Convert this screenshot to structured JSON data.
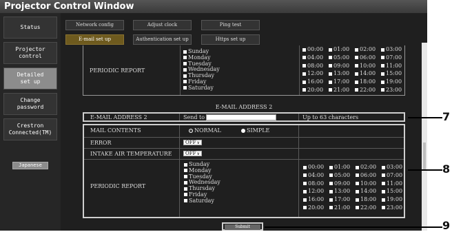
{
  "window": {
    "title": "Projector Control Window"
  },
  "sidebar": {
    "items": [
      {
        "label": "Status",
        "active": false
      },
      {
        "label": "Projector\ncontrol",
        "active": false
      },
      {
        "label": "Detailed\nset up",
        "active": true
      },
      {
        "label": "Change\npassword",
        "active": false
      },
      {
        "label": "Crestron\nConnected(TM)",
        "active": false
      }
    ],
    "language_button": "Japanese"
  },
  "tabs": [
    {
      "label": "Network config",
      "active": false
    },
    {
      "label": "Adjust clock",
      "active": false
    },
    {
      "label": "Ping test",
      "active": false
    },
    {
      "label": "E-mail set up",
      "active": true
    },
    {
      "label": "Authentication set up",
      "active": false
    },
    {
      "label": "Https set up",
      "active": false
    }
  ],
  "top_partial": {
    "periodic_label": "PERIODIC REPORT",
    "days": [
      "Sunday",
      "Monday",
      "Tuesday",
      "Wednesday",
      "Thursday",
      "Friday",
      "Saturday"
    ],
    "times": [
      "00:00",
      "01:00",
      "02:00",
      "03:00",
      "04:00",
      "05:00",
      "06:00",
      "07:00",
      "08:00",
      "09:00",
      "10:00",
      "11:00",
      "12:00",
      "13:00",
      "14:00",
      "15:00",
      "16:00",
      "17:00",
      "18:00",
      "19:00",
      "20:00",
      "21:00",
      "22:00",
      "23:00"
    ]
  },
  "section2": {
    "header": "E-MAIL ADDRESS 2",
    "address_label": "E-MAIL ADDRESS 2",
    "send_to_label": "Send to",
    "send_to_value": "",
    "hint": "Up to 63 characters",
    "mail_contents_label": "MAIL CONTENTS",
    "option_normal": "NORMAL",
    "option_simple": "SIMPLE",
    "selected_option": "NORMAL",
    "error_label": "ERROR",
    "error_value": "OFF",
    "intake_label": "INTAKE AIR TEMPERATURE",
    "intake_value": "OFF",
    "periodic_label": "PERIODIC REPORT",
    "days": [
      "Sunday",
      "Monday",
      "Tuesday",
      "Wednesday",
      "Thursday",
      "Friday",
      "Saturday"
    ],
    "times": [
      "00:00",
      "01:00",
      "02:00",
      "03:00",
      "04:00",
      "05:00",
      "06:00",
      "07:00",
      "08:00",
      "09:00",
      "10:00",
      "11:00",
      "12:00",
      "13:00",
      "14:00",
      "15:00",
      "16:00",
      "17:00",
      "18:00",
      "19:00",
      "20:00",
      "21:00",
      "22:00",
      "23:00"
    ]
  },
  "submit_label": "Submit",
  "callouts": [
    "7",
    "8",
    "9"
  ]
}
